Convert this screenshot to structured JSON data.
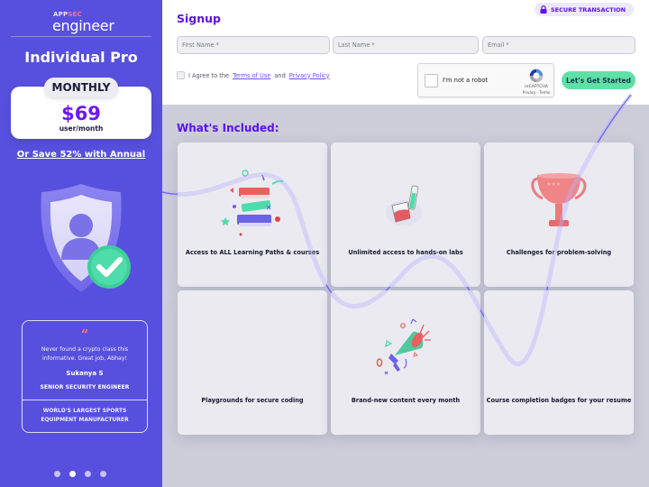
{
  "sidebar": {
    "logo": {
      "top": "APP",
      "top_accent": "SEC",
      "main": "engineer"
    },
    "plan_title": "Individual Pro",
    "billing_period": "MONTHLY",
    "price": "$69",
    "price_unit": "user/month",
    "save_link": "Or Save 52% with Annual",
    "testimonial": {
      "quote_mark": "“",
      "quote": "Never found a crypto class this informative. Great job, Abhay!",
      "author": "Sukanya S",
      "role": "SENIOR SECURITY ENGINEER",
      "company": "WORLD'S LARGEST SPORTS EQUIPMENT MANUFACTURER"
    },
    "carousel": {
      "count": 4,
      "active_index": 1
    }
  },
  "signup": {
    "title": "Signup",
    "secure_badge": "SECURE TRANSACTION",
    "fields": {
      "first_name": {
        "placeholder": "First Name *",
        "value": ""
      },
      "last_name": {
        "placeholder": "Last Name *",
        "value": ""
      },
      "email": {
        "placeholder": "Email *",
        "value": ""
      }
    },
    "agree": {
      "prefix": "I Agree to the",
      "terms": "Terms of Use",
      "conjunction": "and",
      "privacy": "Privacy Policy",
      "checked": false
    },
    "recaptcha": {
      "label": "I'm not a robot",
      "brand": "reCAPTCHA",
      "links": "Privacy - Terms",
      "checked": false
    },
    "cta": "Let's Get Started"
  },
  "included": {
    "title": "What's Included:",
    "features": [
      {
        "label": "Access to ALL Learning Paths & courses",
        "icon": "books-icon"
      },
      {
        "label": "Unlimited access to hands-on labs",
        "icon": "lab-beaker-icon"
      },
      {
        "label": "Challenges for problem-solving",
        "icon": "trophy-icon"
      },
      {
        "label": "Playgrounds for secure coding",
        "icon": ""
      },
      {
        "label": "Brand-new content every month",
        "icon": "megaphone-icon"
      },
      {
        "label": "Course completion badges for your resume",
        "icon": ""
      }
    ]
  },
  "colors": {
    "sidebar_bg": "#5750de",
    "accent_purple": "#5a12e8",
    "cta_green": "#5ee0a6",
    "page_bg": "#cccdd9",
    "card_bg": "#ebeaf0"
  }
}
